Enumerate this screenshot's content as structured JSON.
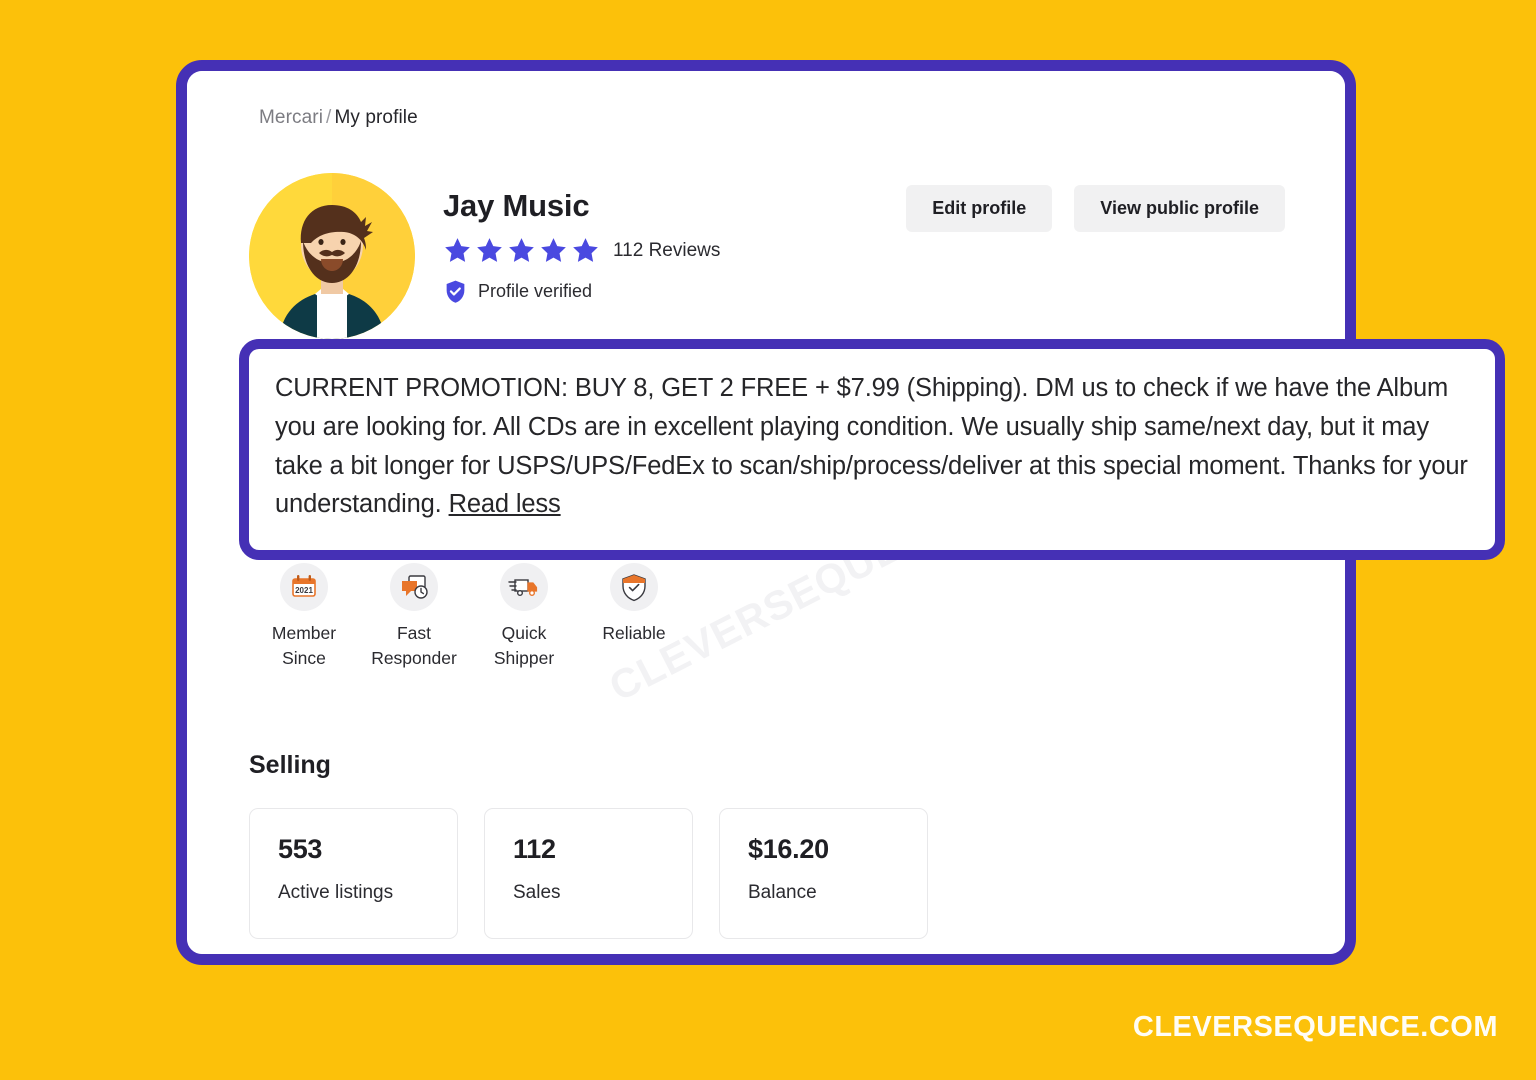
{
  "colors": {
    "page_background": "#FCC10A",
    "frame_purple": "#4530B5",
    "star_blue": "#4A49E0",
    "badge_orange": "#E8752A",
    "avatar_yellow": "#FFD93B"
  },
  "breadcrumb": {
    "root": "Mercari",
    "separator": "/",
    "current": "My profile"
  },
  "profile": {
    "name": "Jay Music",
    "stars": 5,
    "reviews": "112 Reviews",
    "verified_label": "Profile verified",
    "avatar_icon": "user-avatar-bearded-man"
  },
  "header_actions": {
    "edit_profile": "Edit profile",
    "view_public_profile": "View public profile"
  },
  "promotion": {
    "body": "CURRENT PROMOTION: BUY 8, GET 2 FREE + $7.99 (Shipping). DM us to check if we have the Album you are looking for. All CDs are in excellent playing condition. We usually ship same/next day, but it may take a bit longer for USPS/UPS/FedEx to scan/ship/process/deliver at this special moment. Thanks for your understanding. ",
    "read_toggle": "Read less"
  },
  "badges": [
    {
      "icon": "calendar-icon",
      "icon_text": "2021",
      "line1": "Member",
      "line2": "Since"
    },
    {
      "icon": "chat-clock-icon",
      "icon_text": "",
      "line1": "Fast",
      "line2": "Responder"
    },
    {
      "icon": "truck-icon",
      "icon_text": "",
      "line1": "Quick",
      "line2": "Shipper"
    },
    {
      "icon": "shield-check-icon",
      "icon_text": "",
      "line1": "Reliable",
      "line2": ""
    }
  ],
  "selling": {
    "title": "Selling",
    "cards": [
      {
        "value": "553",
        "label": "Active listings"
      },
      {
        "value": "112",
        "label": "Sales"
      },
      {
        "value": "$16.20",
        "label": "Balance"
      }
    ]
  },
  "watermark": {
    "diagonal": "CLEVERSEQUENCE.COM",
    "corner": "CLEVERSEQUENCE.COM"
  }
}
